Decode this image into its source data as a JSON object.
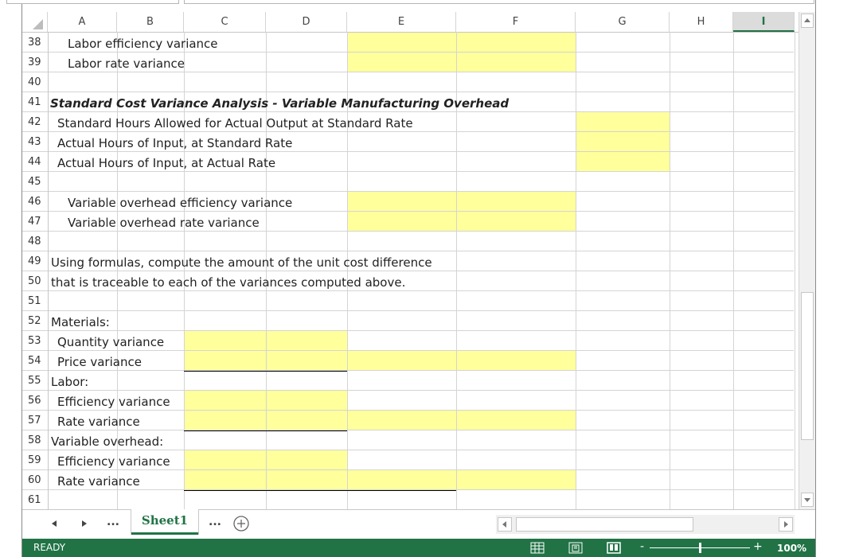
{
  "columns": [
    "A",
    "B",
    "C",
    "D",
    "E",
    "F",
    "G",
    "H",
    "I"
  ],
  "selected_column": "I",
  "row_numbers": [
    "38",
    "39",
    "40",
    "41",
    "42",
    "43",
    "44",
    "45",
    "46",
    "47",
    "48",
    "49",
    "50",
    "51",
    "52",
    "53",
    "54",
    "55",
    "56",
    "57",
    "58",
    "59",
    "60",
    "61"
  ],
  "cells": {
    "r38": "Labor efficiency variance",
    "r39": "Labor rate variance",
    "r41": "Standard Cost Variance Analysis - Variable Manufacturing Overhead",
    "r42": "Standard Hours Allowed for Actual Output at Standard Rate",
    "r43": "Actual Hours of Input, at Standard Rate",
    "r44": "Actual Hours of Input, at Actual Rate",
    "r46": "Variable overhead efficiency variance",
    "r47": "Variable overhead rate variance",
    "r49": "Using formulas, compute the amount of the unit cost difference",
    "r50": "that is traceable to each of the variances computed above.",
    "r52": "Materials:",
    "r53": "Quantity variance",
    "r54": "Price variance",
    "r55": "Labor:",
    "r56": "Efficiency variance",
    "r57": "Rate variance",
    "r58": "Variable overhead:",
    "r59": "Efficiency variance",
    "r60": "Rate variance"
  },
  "sheet_tabs": {
    "prev_more": "...",
    "active": "Sheet1",
    "next_more": "..."
  },
  "status": {
    "mode": "READY",
    "zoom": "100%"
  },
  "colors": {
    "highlight": "#ffff9c",
    "excel_green": "#217346"
  }
}
